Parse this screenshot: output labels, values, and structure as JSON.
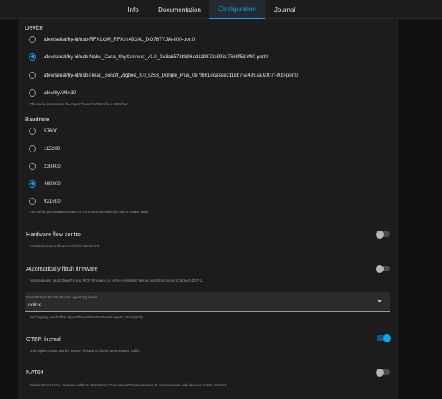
{
  "tabs": [
    {
      "label": "Info"
    },
    {
      "label": "Documentation"
    },
    {
      "label": "Configuration"
    },
    {
      "label": "Journal"
    }
  ],
  "device": {
    "title": "Device",
    "options": [
      {
        "label": "/dev/serial/by-id/usb-RFXCOM_RFXtrx433XL_DO76TYJW-if00-port0"
      },
      {
        "label": "/dev/serial/by-id/usb-Nabu_Casa_SkyConnect_v1.0_2e3ab573bb96ed119872c998a7669f5d-if00-port0"
      },
      {
        "label": "/dev/serial/by-id/usb-ITead_Sonoff_Zigbee_3.0_USB_Dongle_Plus_0e7fb61eca3aec11bb75a4957a0af07f-if00-port0"
      },
      {
        "label": "/dev/ttyAMA10"
      }
    ],
    "selected_index": 1,
    "helper": "The serial port where the OpenThread RCP radio is attached."
  },
  "baudrate": {
    "title": "Baudrate",
    "options": [
      {
        "label": "57600"
      },
      {
        "label": "115200"
      },
      {
        "label": "230400"
      },
      {
        "label": "460800"
      },
      {
        "label": "921600"
      }
    ],
    "selected_index": 3,
    "helper": "The serial port baudrate used to communicate with the Silicon Labs radio."
  },
  "hardware_flow_control": {
    "title": "Hardware flow control",
    "helper": "Enable hardware flow control for serial port.",
    "enabled": false
  },
  "auto_flash": {
    "title": "Automatically flash firmware",
    "helper": "Automatically flash OpenThread RCP firmware on Home Assistant Yellow and SkyConnect/Connect ZBT-1.",
    "enabled": false
  },
  "log_level": {
    "label": "OpenThread Border Router agent log level*",
    "value": "notice",
    "helper": "Set logging level of the OpenThread Border Router agent (otbr-agent)."
  },
  "otbr_firewall": {
    "title": "OTBR firewall",
    "helper": "Use OpenThread Border Router firewall to block unnecessary traffic.",
    "enabled": true
  },
  "nat64": {
    "title": "NAT64",
    "helper": "Enable IPv6 to IPv4 network address translation. This allows Thread devices to communicate with devices on the internet.",
    "enabled": false
  },
  "colors": {
    "accent": "#03a9f4",
    "background": "#111111",
    "card": "#1c1c1c"
  }
}
